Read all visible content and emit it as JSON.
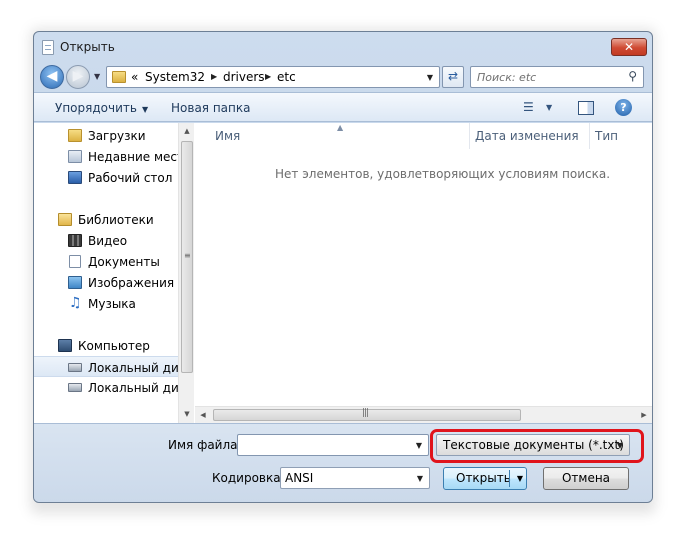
{
  "window": {
    "title": "Открыть",
    "close_label": "✕"
  },
  "navigation": {
    "back_icon": "arrow-left-icon",
    "forward_icon": "arrow-right-icon",
    "address": {
      "prefix": "«",
      "parts": [
        "System32",
        "drivers",
        "etc"
      ]
    },
    "refresh_icon": "refresh-icon",
    "search_placeholder": "Поиск: etc"
  },
  "toolbar": {
    "organize_label": "Упорядочить",
    "new_folder_label": "Новая папка",
    "view_icon": "view-list-icon",
    "preview_icon": "preview-pane-icon",
    "help_label": "?"
  },
  "sidebar": {
    "items": [
      {
        "label": "Загрузки",
        "icon": "downloads-folder-icon"
      },
      {
        "label": "Недавние места",
        "icon": "recent-places-icon"
      },
      {
        "label": "Рабочий стол",
        "icon": "desktop-icon"
      },
      {
        "label": "Библиотеки",
        "icon": "libraries-icon"
      },
      {
        "label": "Видео",
        "icon": "video-library-icon"
      },
      {
        "label": "Документы",
        "icon": "documents-library-icon"
      },
      {
        "label": "Изображения",
        "icon": "pictures-library-icon"
      },
      {
        "label": "Музыка",
        "icon": "music-library-icon"
      },
      {
        "label": "Компьютер",
        "icon": "computer-icon"
      },
      {
        "label": "Локальный диск",
        "icon": "local-disk-icon"
      },
      {
        "label": "Локальный диск",
        "icon": "local-disk-icon"
      }
    ]
  },
  "file_list": {
    "columns": [
      "Имя",
      "Дата изменения",
      "Тип"
    ],
    "empty_message": "Нет элементов, удовлетворяющих условиям поиска."
  },
  "bottom": {
    "filename_label": "Имя файла:",
    "filename_value": "",
    "filetype_value": "Текстовые документы (*.txt)",
    "encoding_label": "Кодировка:",
    "encoding_value": "ANSI",
    "open_label": "Открыть",
    "cancel_label": "Отмена"
  },
  "colors": {
    "highlight": "#e0141c",
    "window_frame": "#b9cbe2",
    "toolbar_text": "#1e395b"
  }
}
